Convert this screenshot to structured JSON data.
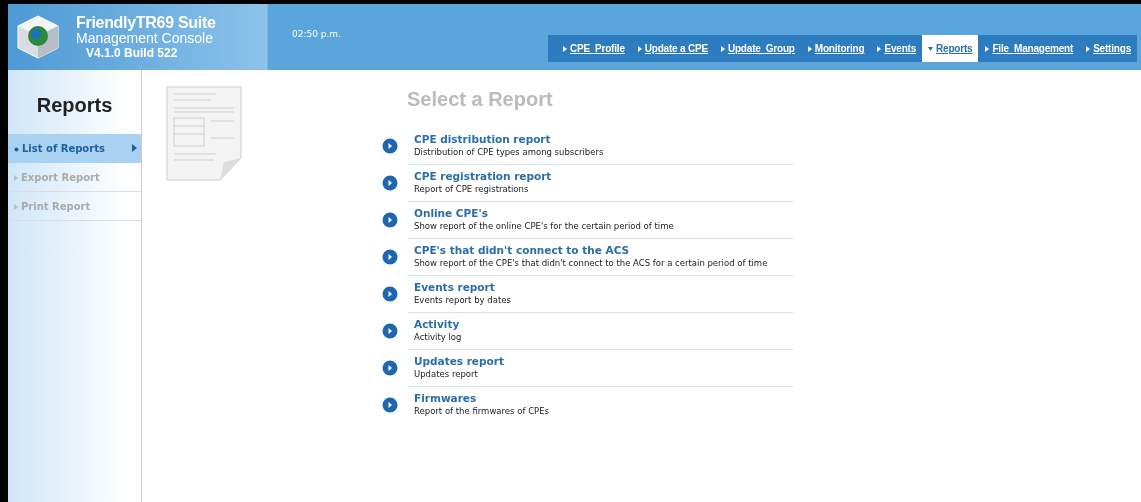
{
  "header": {
    "product": "FriendlyTR69 Suite",
    "subtitle": "Management Console",
    "version": "V4.1.0 Build 522",
    "time": "02:50 p.m."
  },
  "nav": [
    {
      "label": "CPE  Profile",
      "selected": false
    },
    {
      "label": "Update a CPE",
      "selected": false
    },
    {
      "label": "Update  Group",
      "selected": false
    },
    {
      "label": "Monitoring",
      "selected": false
    },
    {
      "label": "Events",
      "selected": false
    },
    {
      "label": "Reports",
      "selected": true
    },
    {
      "label": "File  Management",
      "selected": false
    },
    {
      "label": "Settings",
      "selected": false
    }
  ],
  "sidebar": {
    "title": "Reports",
    "items": [
      {
        "label": "List of Reports",
        "selected": true,
        "disabled": false
      },
      {
        "label": "Export Report",
        "selected": false,
        "disabled": true
      },
      {
        "label": "Print Report",
        "selected": false,
        "disabled": true
      }
    ]
  },
  "main": {
    "title": "Select a Report",
    "reports": [
      {
        "title": "CPE distribution report",
        "description": "Distribution of CPE types among subscribers"
      },
      {
        "title": "CPE registration report",
        "description": "Report of CPE registrations"
      },
      {
        "title": "Online CPE's",
        "description": "Show report of the online CPE's for the certain period of time"
      },
      {
        "title": "CPE's that didn't connect to the ACS",
        "description": "Show report of the CPE's that didn't connect to the ACS for a certain period of time"
      },
      {
        "title": "Events report",
        "description": "Events report by dates"
      },
      {
        "title": "Activity",
        "description": "Activity log"
      },
      {
        "title": "Updates report",
        "description": "Updates report"
      },
      {
        "title": "Firmwares",
        "description": "Report of the firmwares of CPEs"
      }
    ]
  }
}
